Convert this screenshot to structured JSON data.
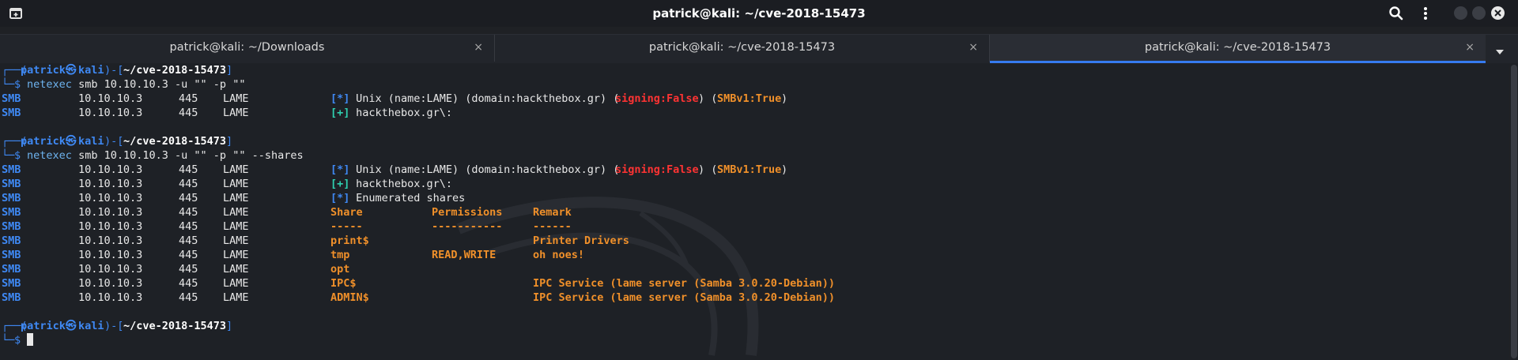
{
  "window": {
    "title": "patrick@kali: ~/cve-2018-15473",
    "icons": {
      "new_tab": "new-tab-icon",
      "search": "search-icon",
      "menu": "kebab-menu-icon",
      "minimize": "minimize-icon",
      "maximize": "maximize-icon",
      "close": "close-icon"
    }
  },
  "tabs": [
    {
      "label": "patrick@kali: ~/Downloads",
      "close": "×",
      "active": false
    },
    {
      "label": "patrick@kali: ~/cve-2018-15473",
      "close": "×",
      "active": false
    },
    {
      "label": "patrick@kali: ~/cve-2018-15473",
      "close": "×",
      "active": true
    }
  ],
  "colors": {
    "accent": "#367bf0",
    "prompt": "#3f89f4",
    "orange": "#f0902a",
    "red": "#ff3333",
    "green": "#2fd0b0"
  },
  "terminal": {
    "prompt": {
      "box_top": "┌──(",
      "user": "patrick",
      "at": "㉿",
      "host": "kali",
      "mid": ")-[",
      "path": "~/cve-2018-15473",
      "end": "]",
      "box_bottom": "└─",
      "dollar": "$"
    },
    "commands": [
      {
        "cmd": "netexec",
        "args": " smb 10.10.10.3 -u \"\" -p \"\""
      },
      {
        "cmd": "netexec",
        "args": " smb 10.10.10.3 -u \"\" -p \"\" --shares"
      }
    ],
    "smb_prefix": {
      "proto": "SMB",
      "ip": "10.10.10.3",
      "port": "445",
      "host": "LAME"
    },
    "info_line": {
      "tag": "[*]",
      "text": " Unix (name:LAME) (domain:hackthebox.gr) (",
      "signing": "signing:False",
      "mid": ") (",
      "smbv1": "SMBv1:True",
      "end": ")"
    },
    "success_line": {
      "tag": "[+]",
      "text": " hackthebox.gr\\:"
    },
    "enum_line": {
      "tag": "[*]",
      "text": " Enumerated shares"
    },
    "share_headers": {
      "share": "Share",
      "permissions": "Permissions",
      "remark": "Remark"
    },
    "share_dividers": {
      "share": "-----",
      "permissions": "-----------",
      "remark": "------"
    },
    "shares": [
      {
        "share": "print$",
        "permissions": "",
        "remark": "Printer Drivers"
      },
      {
        "share": "tmp",
        "permissions": "READ,WRITE",
        "remark": "oh noes!"
      },
      {
        "share": "opt",
        "permissions": "",
        "remark": ""
      },
      {
        "share": "IPC$",
        "permissions": "",
        "remark": "IPC Service (lame server (Samba 3.0.20-Debian))"
      },
      {
        "share": "ADMIN$",
        "permissions": "",
        "remark": "IPC Service (lame server (Samba 3.0.20-Debian))"
      }
    ]
  }
}
